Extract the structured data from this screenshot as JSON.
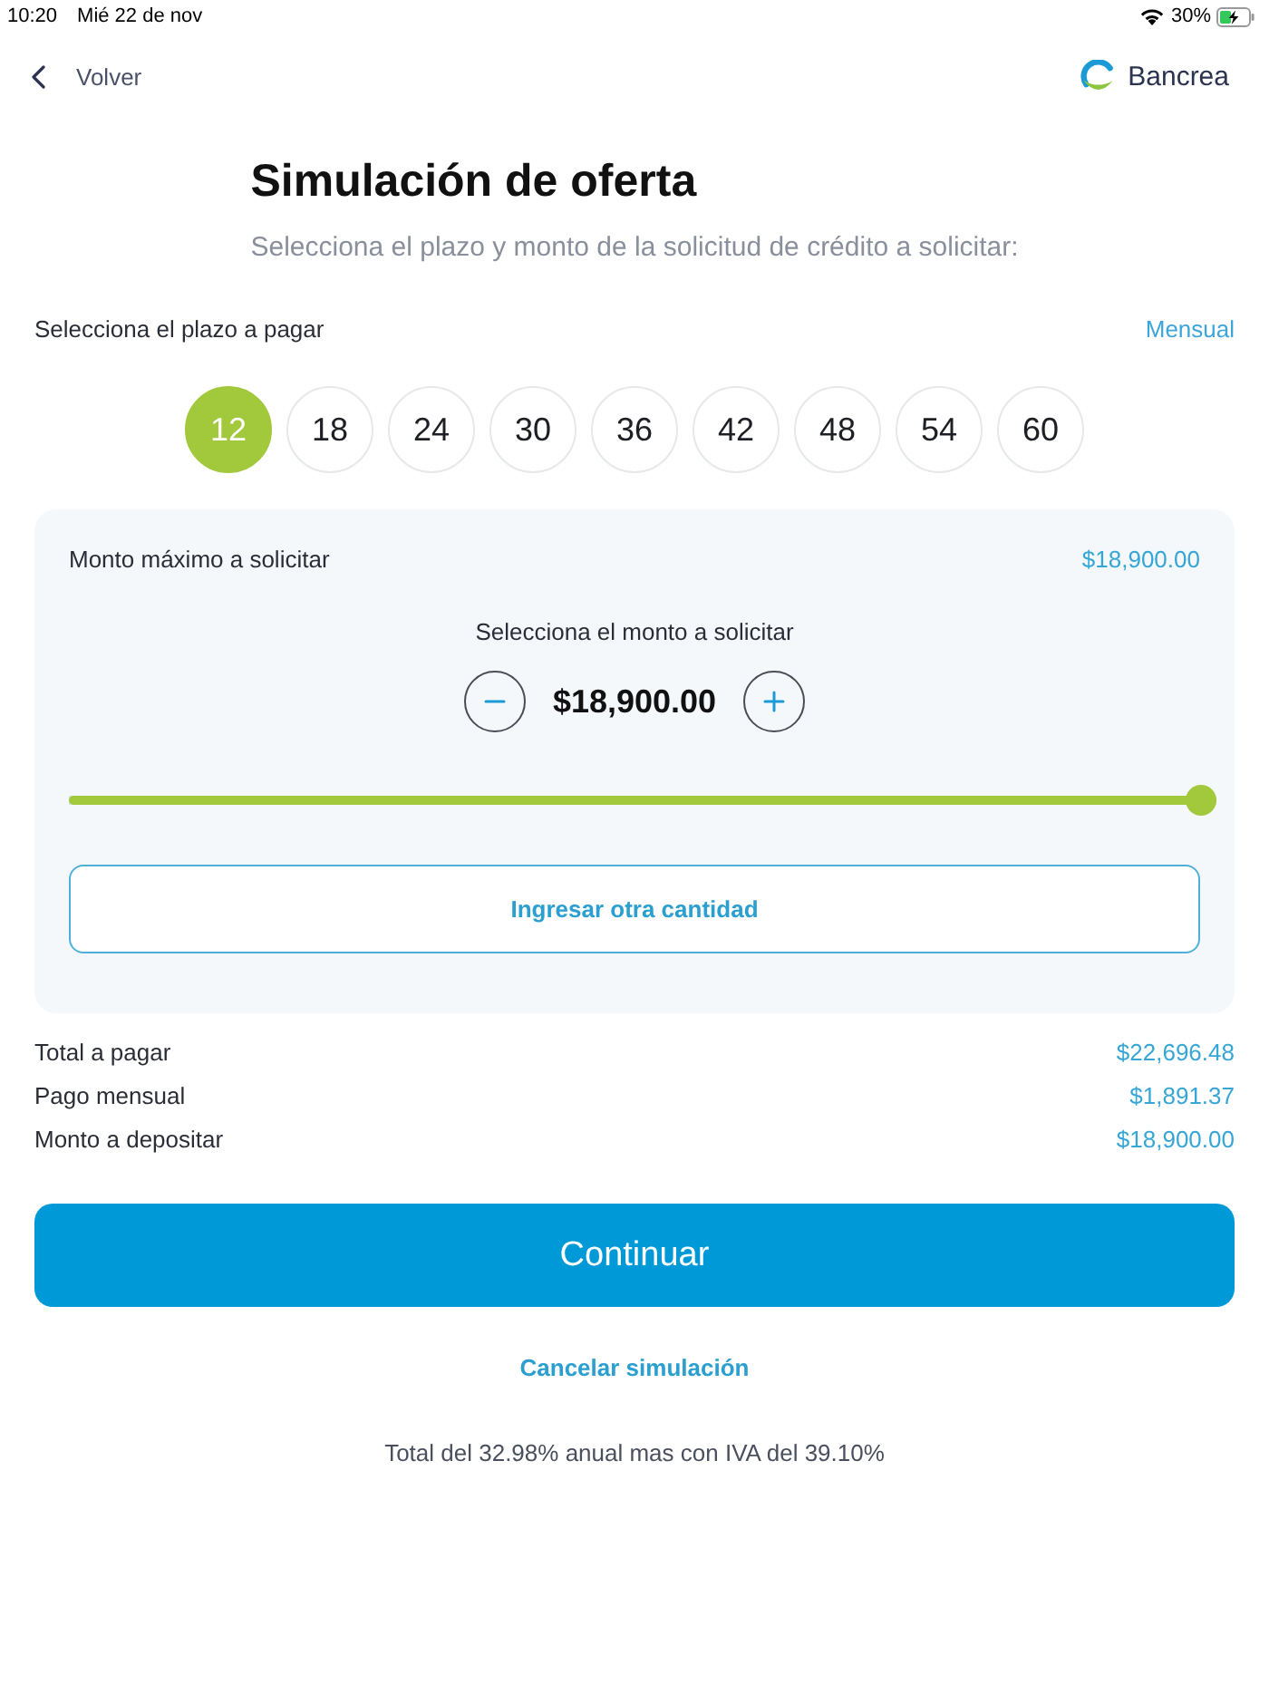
{
  "status_bar": {
    "time": "10:20",
    "date": "Mié 22 de nov",
    "battery": "30%"
  },
  "nav": {
    "back": "Volver",
    "brand": "Bancrea"
  },
  "header": {
    "title": "Simulación de oferta",
    "subtitle": "Selecciona el plazo y monto de la solicitud de crédito a solicitar:"
  },
  "term": {
    "label": "Selecciona el plazo a pagar",
    "frequency": "Mensual",
    "options": [
      {
        "label": "12",
        "selected": true
      },
      {
        "label": "18",
        "selected": false
      },
      {
        "label": "24",
        "selected": false
      },
      {
        "label": "30",
        "selected": false
      },
      {
        "label": "36",
        "selected": false
      },
      {
        "label": "42",
        "selected": false
      },
      {
        "label": "48",
        "selected": false
      },
      {
        "label": "54",
        "selected": false
      },
      {
        "label": "60",
        "selected": false
      }
    ]
  },
  "amount": {
    "max_label": "Monto máximo a solicitar",
    "max_value": "$18,900.00",
    "prompt": "Selecciona el monto a solicitar",
    "value": "$18,900.00",
    "slider": {
      "level": 1
    },
    "other_amount": "Ingresar otra cantidad"
  },
  "summary": [
    {
      "label": "Total a pagar",
      "value": "$22,696.48"
    },
    {
      "label": "Pago mensual",
      "value": "$1,891.37"
    },
    {
      "label": "Monto a depositar",
      "value": "$18,900.00"
    }
  ],
  "actions": {
    "primary": "Continuar",
    "cancel": "Cancelar simulación"
  },
  "footnote": "Total del 32.98% anual mas con IVA del 39.10%"
}
